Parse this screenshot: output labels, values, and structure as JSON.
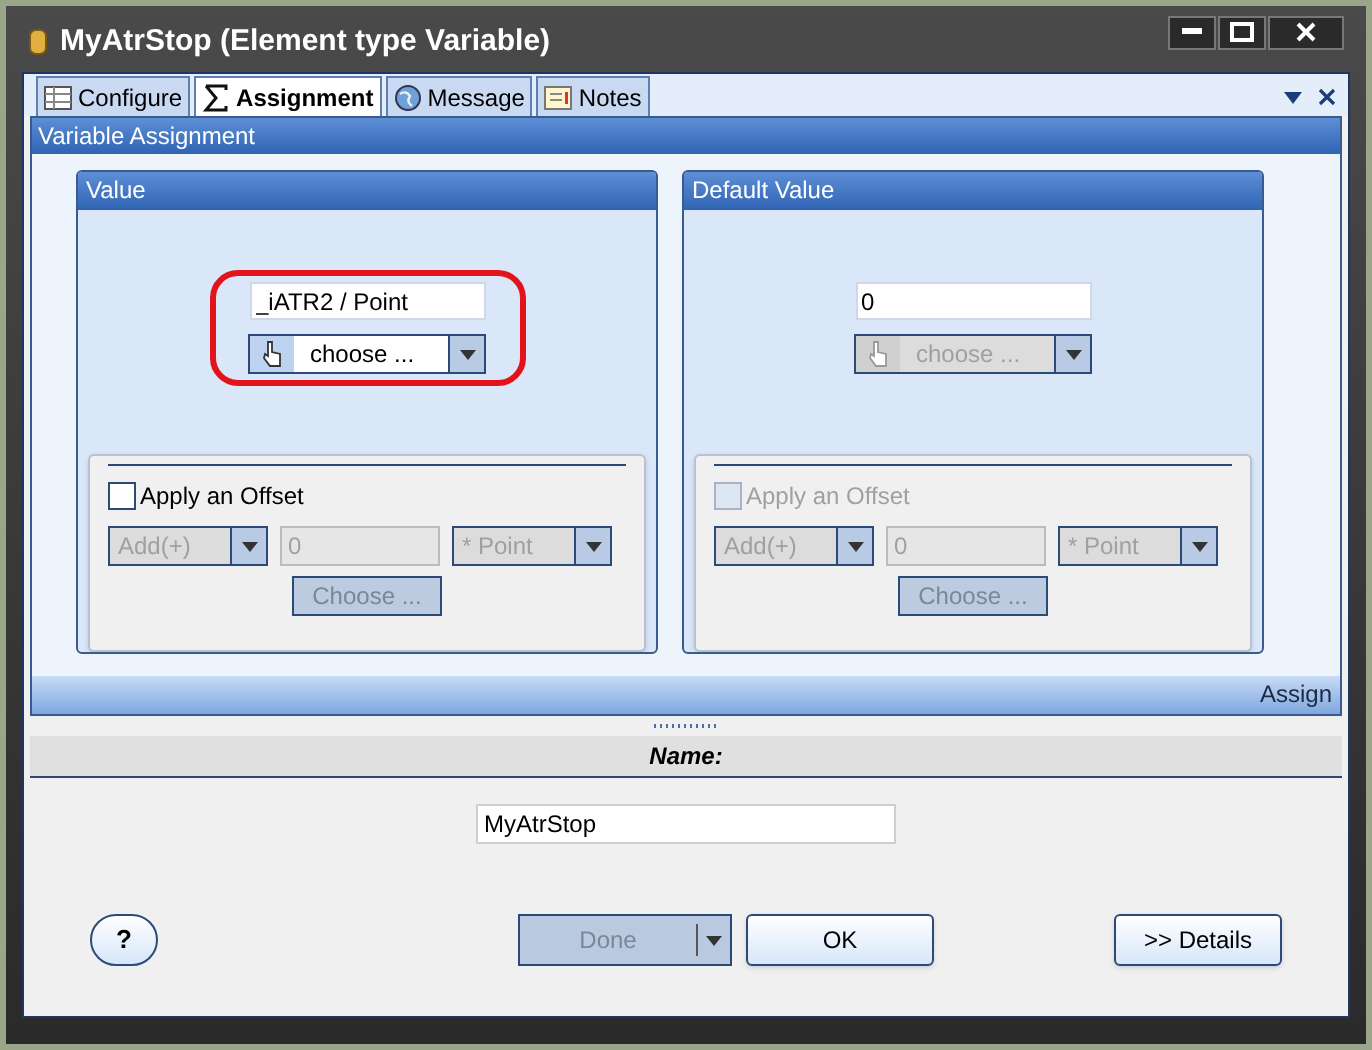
{
  "window": {
    "title": "MyAtrStop (Element type Variable)"
  },
  "tabs": [
    {
      "label": "Configure",
      "selected": false,
      "kind": "table"
    },
    {
      "label": "Assignment",
      "selected": true,
      "kind": "sigma"
    },
    {
      "label": "Message",
      "selected": false,
      "kind": "globe"
    },
    {
      "label": "Notes",
      "selected": false,
      "kind": "note"
    }
  ],
  "section": {
    "title": "Variable Assignment",
    "footer": "Assign"
  },
  "groups": [
    {
      "title": "Value",
      "value": "_iATR2 / Point",
      "highlighted": true,
      "chooser": {
        "label": "choose ...",
        "disabled": false
      },
      "offset": {
        "label": "Apply an Offset",
        "checked": false,
        "disabled": false,
        "fields_disabled": true,
        "operation": "Add(+)",
        "amount": "0",
        "unit": "* Point",
        "button": "Choose ..."
      }
    },
    {
      "title": "Default Value",
      "value": "0",
      "highlighted": false,
      "chooser": {
        "label": "choose ...",
        "disabled": true
      },
      "offset": {
        "label": "Apply an Offset",
        "checked": false,
        "disabled": true,
        "fields_disabled": true,
        "operation": "Add(+)",
        "amount": "0",
        "unit": "* Point",
        "button": "Choose ..."
      }
    }
  ],
  "name": {
    "label": "Name:",
    "value": "MyAtrStop"
  },
  "buttons": [
    {
      "label": "?",
      "kind": "help",
      "disabled": false
    },
    {
      "label": "Done",
      "kind": "split",
      "disabled": true
    },
    {
      "label": "OK",
      "kind": "normal",
      "disabled": false
    },
    {
      "label": ">> Details",
      "kind": "normal",
      "disabled": false
    }
  ]
}
